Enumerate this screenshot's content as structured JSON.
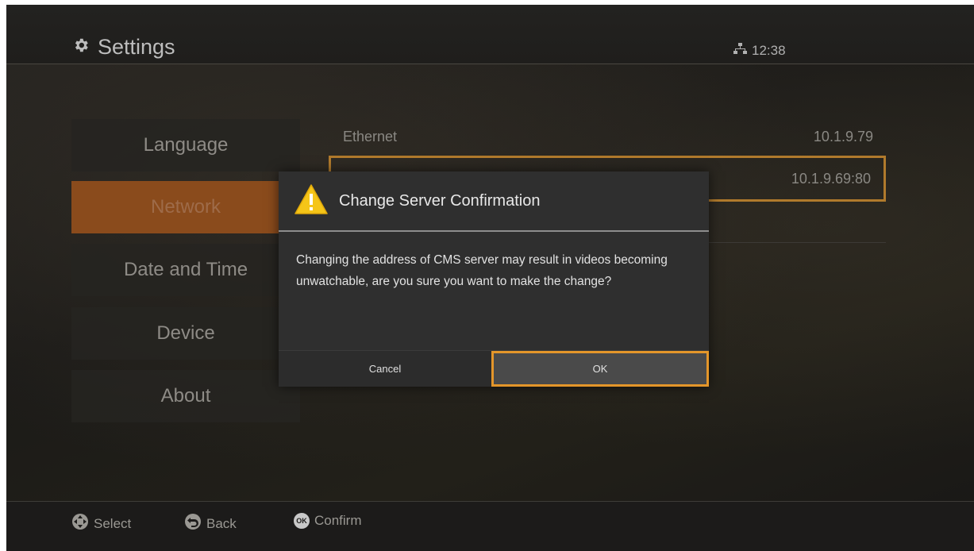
{
  "header": {
    "title": "Settings",
    "time": "12:38"
  },
  "menu": {
    "items": [
      {
        "label": "Language"
      },
      {
        "label": "Network",
        "active": true
      },
      {
        "label": "Date and Time"
      },
      {
        "label": "Device"
      },
      {
        "label": "About"
      }
    ]
  },
  "network": {
    "rows": [
      {
        "label": "Ethernet",
        "value": "10.1.9.79"
      },
      {
        "label": "",
        "value": "10.1.9.69:80"
      }
    ]
  },
  "dialog": {
    "title": "Change Server Confirmation",
    "message": "Changing the address of CMS server may result in videos becoming unwatchable, are you sure you want to make the change?",
    "cancel_label": "Cancel",
    "ok_label": "OK"
  },
  "footer": {
    "select_label": "Select",
    "back_label": "Back",
    "ok_badge": "OK",
    "confirm_label": "Confirm"
  },
  "colors": {
    "accent": "#e4962a",
    "active_menu": "#8a4b1c",
    "warning_icon": "#f5c518"
  },
  "icons": [
    "gear-icon",
    "network-icon",
    "warning-icon",
    "dpad-icon",
    "back-icon",
    "ok-icon"
  ]
}
